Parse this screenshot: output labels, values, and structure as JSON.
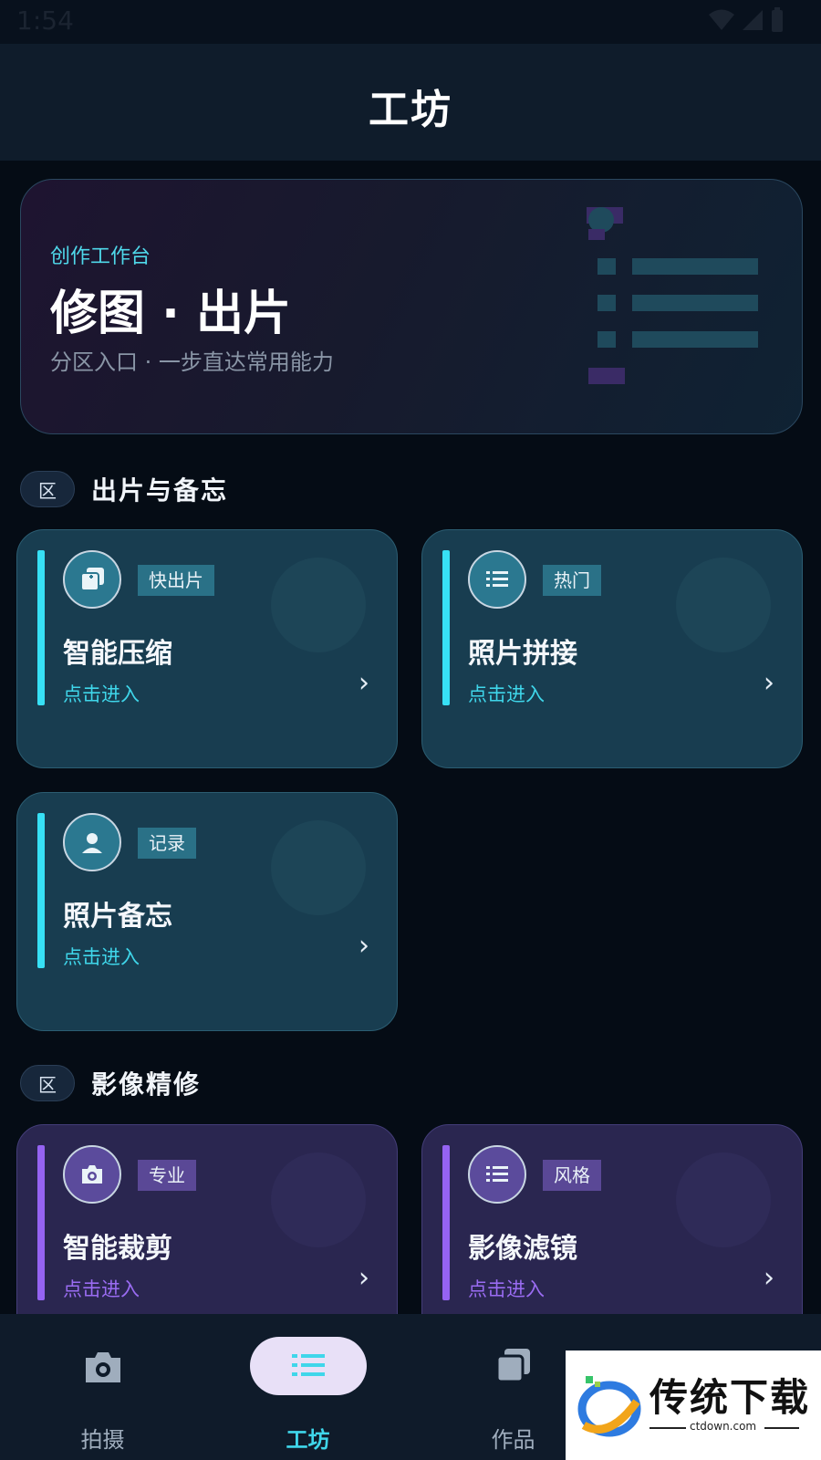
{
  "status_bar": {
    "time": "1:54"
  },
  "header": {
    "title": "工坊"
  },
  "hero": {
    "eyebrow": "创作工作台",
    "headline": "修图 · 出片",
    "subtitle": "分区入口 · 一步直达常用能力"
  },
  "sections": [
    {
      "badge": "区",
      "title": "出片与备忘",
      "cards": [
        {
          "title": "智能压缩",
          "tag": "快出片",
          "cta": "点击进入",
          "icon": "photo-stack-icon",
          "theme": "teal"
        },
        {
          "title": "照片拼接",
          "tag": "热门",
          "cta": "点击进入",
          "icon": "list-icon",
          "theme": "teal"
        },
        {
          "title": "照片备忘",
          "tag": "记录",
          "cta": "点击进入",
          "icon": "person-icon",
          "theme": "teal"
        }
      ]
    },
    {
      "badge": "区",
      "title": "影像精修",
      "cards": [
        {
          "title": "智能裁剪",
          "tag": "专业",
          "cta": "点击进入",
          "icon": "camera-icon",
          "theme": "purple"
        },
        {
          "title": "影像滤镜",
          "tag": "风格",
          "cta": "点击进入",
          "icon": "list-icon",
          "theme": "purple"
        }
      ]
    }
  ],
  "tab_bar": {
    "active": 1,
    "tabs": [
      {
        "label": "拍摄",
        "icon": "camera-icon"
      },
      {
        "label": "工坊",
        "icon": "list-icon"
      },
      {
        "label": "作品",
        "icon": "photo-stack-icon"
      }
    ]
  },
  "watermark": {
    "text": "传统下载",
    "url": "ctdown.com"
  },
  "colors": {
    "accent_teal": "#37e0f5",
    "accent_purple": "#9563f2",
    "background": "#050c15",
    "tab_active_pill": "#e8e0f7"
  }
}
